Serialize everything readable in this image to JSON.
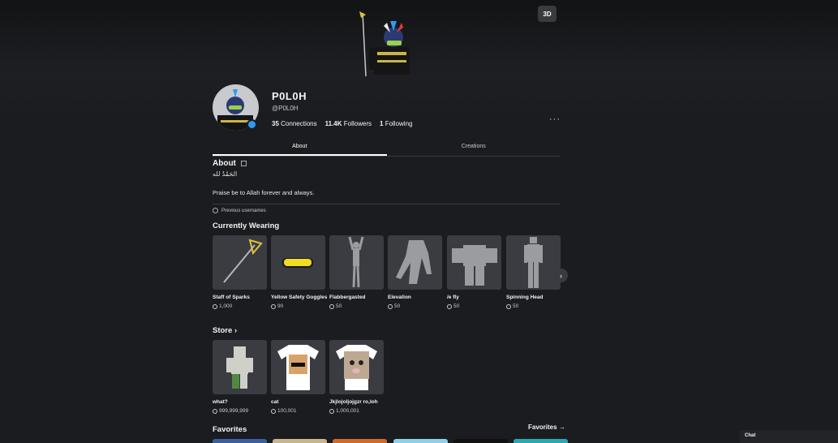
{
  "hero": {
    "view_3d_label": "3D"
  },
  "profile": {
    "display_name": "P0L0H",
    "username": "@P0L0H",
    "connections_count": "35",
    "connections_label": "Connections",
    "followers_count": "11.4K",
    "followers_label": "Followers",
    "following_count": "1",
    "following_label": "Following",
    "more_label": "···"
  },
  "tabs": [
    {
      "label": "About",
      "active": true
    },
    {
      "label": "Creations",
      "active": false
    }
  ],
  "about": {
    "title": "About",
    "arabic_text": "الحَمْدُ لله",
    "bio": "Praise be to Allah forever and always.",
    "previous_usernames_label": "Previous usernames"
  },
  "currently_wearing": {
    "title": "Currently Wearing",
    "items": [
      {
        "name": "Staff of Sparks",
        "price": "1,000"
      },
      {
        "name": "Yellow Safety Goggles",
        "price": "90"
      },
      {
        "name": "Flabbergasted",
        "price": "50"
      },
      {
        "name": "Elevation",
        "price": "50"
      },
      {
        "name": "/e fly",
        "price": "50"
      },
      {
        "name": "Spinning Head",
        "price": "50"
      }
    ]
  },
  "store": {
    "title": "Store",
    "items": [
      {
        "name": "what?",
        "price": "999,999,999"
      },
      {
        "name": "cat",
        "price": "100,001"
      },
      {
        "name": "Jkjlojoljojgzr ro,loh",
        "price": "1,000,001"
      }
    ]
  },
  "favorites": {
    "title": "Favorites",
    "link_label": "Favorites"
  },
  "chat": {
    "label": "Chat"
  },
  "colors": {
    "background": "#1b1c1f",
    "card": "#3a3c41",
    "verified": "#2f9af5"
  }
}
